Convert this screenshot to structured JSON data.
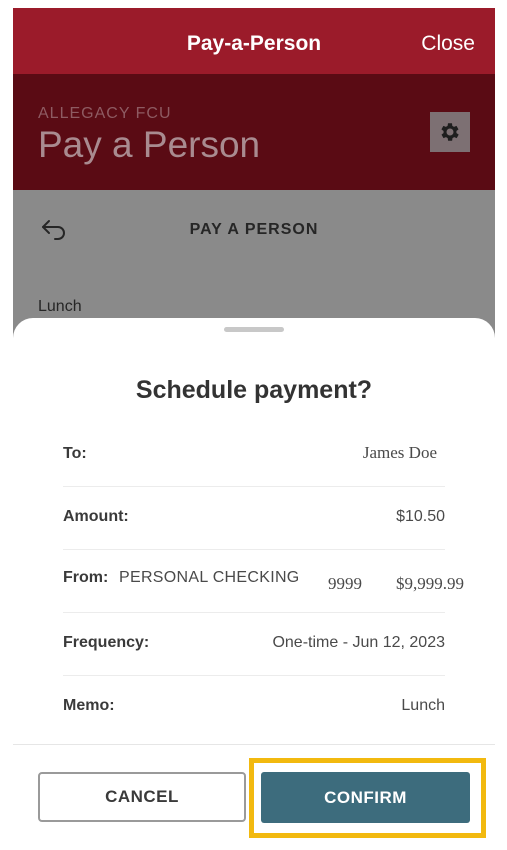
{
  "topbar": {
    "title": "Pay-a-Person",
    "close_label": "Close"
  },
  "brand": {
    "subtitle": "ALLEGACY FCU",
    "title": "Pay a Person",
    "settings_icon": "gear-icon"
  },
  "page": {
    "back_icon": "back-arrow-icon",
    "title": "PAY A PERSON",
    "memo_preview": "Lunch"
  },
  "sheet": {
    "title": "Schedule payment?",
    "to": {
      "label": "To:",
      "value": "James Doe"
    },
    "amount": {
      "label": "Amount:",
      "value": "$10.50"
    },
    "from": {
      "label": "From:",
      "account": "PERSONAL CHECKING",
      "number": "9999",
      "balance": "$9,999.99"
    },
    "frequency": {
      "label": "Frequency:",
      "value": "One-time - Jun 12, 2023"
    },
    "memo": {
      "label": "Memo:",
      "value": "Lunch"
    },
    "cancel_label": "CANCEL",
    "confirm_label": "CONFIRM"
  },
  "colors": {
    "topbar": "#9b1b2a",
    "brand": "#5a0b14",
    "confirm": "#3d6c7d",
    "highlight": "#f2b90f"
  }
}
